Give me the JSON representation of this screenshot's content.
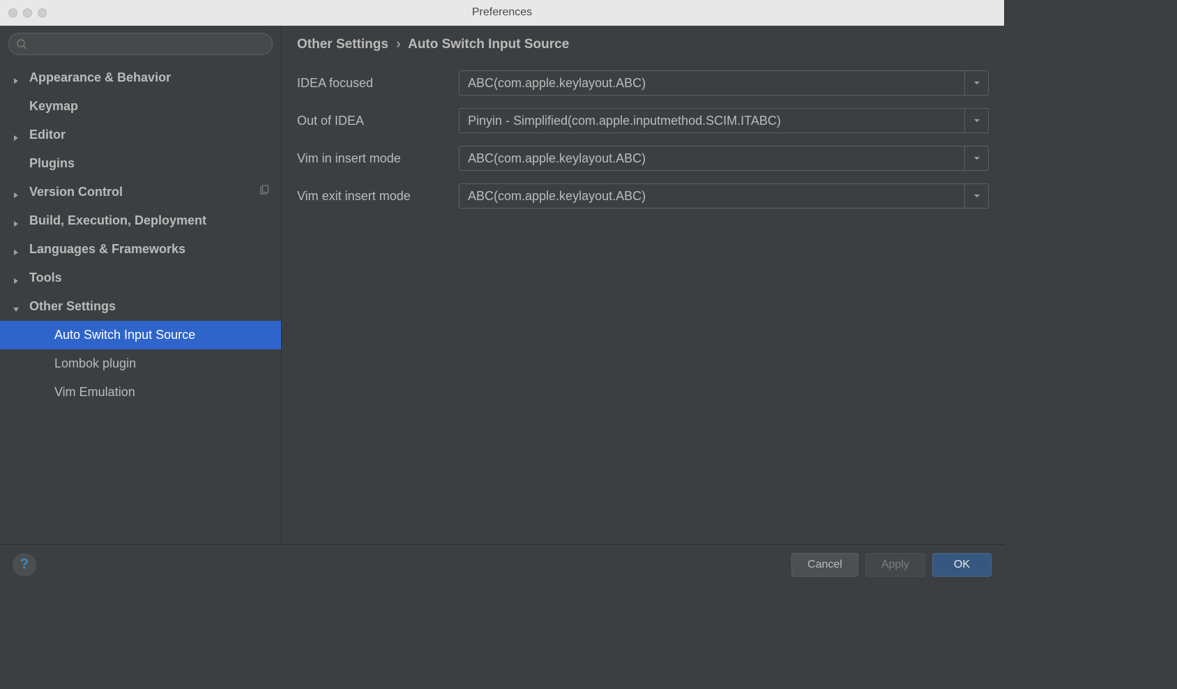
{
  "window": {
    "title": "Preferences"
  },
  "sidebar": {
    "search_placeholder": "",
    "items": [
      {
        "label": "Appearance & Behavior",
        "bold": true,
        "arrow": "right"
      },
      {
        "label": "Keymap",
        "bold": true,
        "arrow": "none"
      },
      {
        "label": "Editor",
        "bold": true,
        "arrow": "right"
      },
      {
        "label": "Plugins",
        "bold": true,
        "arrow": "none"
      },
      {
        "label": "Version Control",
        "bold": true,
        "arrow": "right",
        "righticon": "copy"
      },
      {
        "label": "Build, Execution, Deployment",
        "bold": true,
        "arrow": "right"
      },
      {
        "label": "Languages & Frameworks",
        "bold": true,
        "arrow": "right"
      },
      {
        "label": "Tools",
        "bold": true,
        "arrow": "right"
      },
      {
        "label": "Other Settings",
        "bold": true,
        "arrow": "down"
      },
      {
        "label": "Auto Switch Input Source",
        "bold": false,
        "child": true,
        "selected": true
      },
      {
        "label": "Lombok plugin",
        "bold": false,
        "child": true
      },
      {
        "label": "Vim Emulation",
        "bold": false,
        "child": true
      }
    ]
  },
  "breadcrumb": {
    "parent": "Other Settings",
    "separator": "›",
    "current": "Auto Switch Input Source"
  },
  "form": {
    "rows": [
      {
        "label": "IDEA focused",
        "value": "ABC(com.apple.keylayout.ABC)"
      },
      {
        "label": "Out of IDEA",
        "value": "Pinyin - Simplified(com.apple.inputmethod.SCIM.ITABC)"
      },
      {
        "label": "Vim in insert mode",
        "value": "ABC(com.apple.keylayout.ABC)"
      },
      {
        "label": "Vim exit insert mode",
        "value": "ABC(com.apple.keylayout.ABC)"
      }
    ]
  },
  "footer": {
    "help": "?",
    "cancel": "Cancel",
    "apply": "Apply",
    "ok": "OK"
  }
}
